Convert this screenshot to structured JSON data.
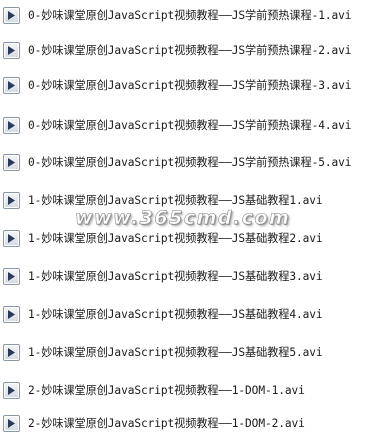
{
  "files": [
    {
      "name": "0-妙味课堂原创JavaScript视频教程——JS学前预热课程-1.avi",
      "icon": "video-file-icon"
    },
    {
      "name": "0-妙味课堂原创JavaScript视频教程——JS学前预热课程-2.avi",
      "icon": "video-file-icon"
    },
    {
      "name": "0-妙味课堂原创JavaScript视频教程——JS学前预热课程-3.avi",
      "icon": "video-file-icon"
    },
    {
      "name": "0-妙味课堂原创JavaScript视频教程——JS学前预热课程-4.avi",
      "icon": "video-file-icon"
    },
    {
      "name": "0-妙味课堂原创JavaScript视频教程——JS学前预热课程-5.avi",
      "icon": "video-file-icon"
    },
    {
      "name": "1-妙味课堂原创JavaScript视频教程——JS基础教程1.avi",
      "icon": "video-file-icon"
    },
    {
      "name": "1-妙味课堂原创JavaScript视频教程——JS基础教程2.avi",
      "icon": "video-file-icon"
    },
    {
      "name": "1-妙味课堂原创JavaScript视频教程——JS基础教程3.avi",
      "icon": "video-file-icon"
    },
    {
      "name": "1-妙味课堂原创JavaScript视频教程——JS基础教程4.avi",
      "icon": "video-file-icon"
    },
    {
      "name": "1-妙味课堂原创JavaScript视频教程——JS基础教程5.avi",
      "icon": "video-file-icon"
    },
    {
      "name": "2-妙味课堂原创JavaScript视频教程——1-DOM-1.avi",
      "icon": "video-file-icon"
    },
    {
      "name": "2-妙味课堂原创JavaScript视频教程——1-DOM-2.avi",
      "icon": "video-file-icon"
    }
  ],
  "watermark": "www.365cmd.com",
  "colors": {
    "icon_play": "#2b3a55",
    "text": "#1a1a1a",
    "background": "#ffffff"
  }
}
